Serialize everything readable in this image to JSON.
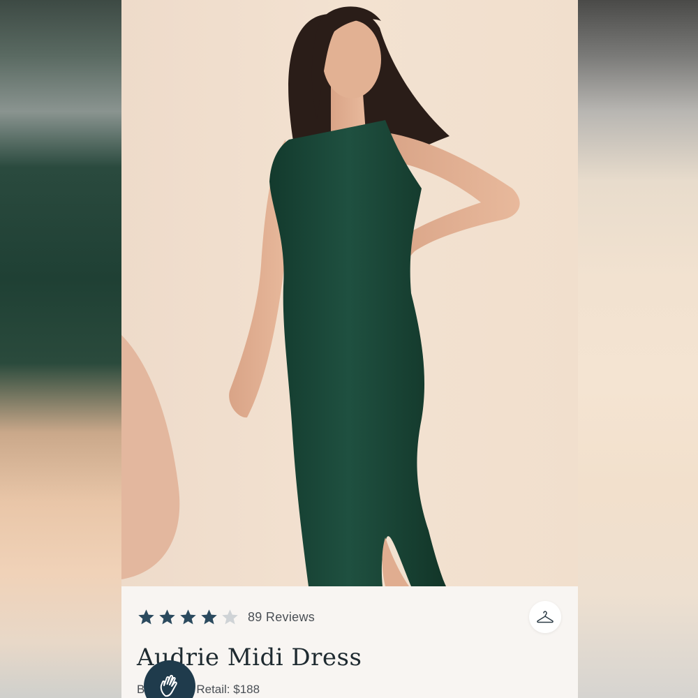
{
  "product": {
    "name": "Audrie Midi Dress",
    "rating": 4,
    "rating_max": 5,
    "reviews_label": "89 Reviews",
    "retail_prefix": "B",
    "retail_label": "Retail: $188"
  },
  "icons": {
    "star_filled": "star-icon",
    "star_empty": "star-empty-icon",
    "hanger": "hanger-icon",
    "hand": "waving-hand-icon"
  },
  "colors": {
    "star_filled": "#2b4a5e",
    "star_empty": "#cfd3d6",
    "dress": "#1d4a3a",
    "badge": "#1f3b4c"
  }
}
